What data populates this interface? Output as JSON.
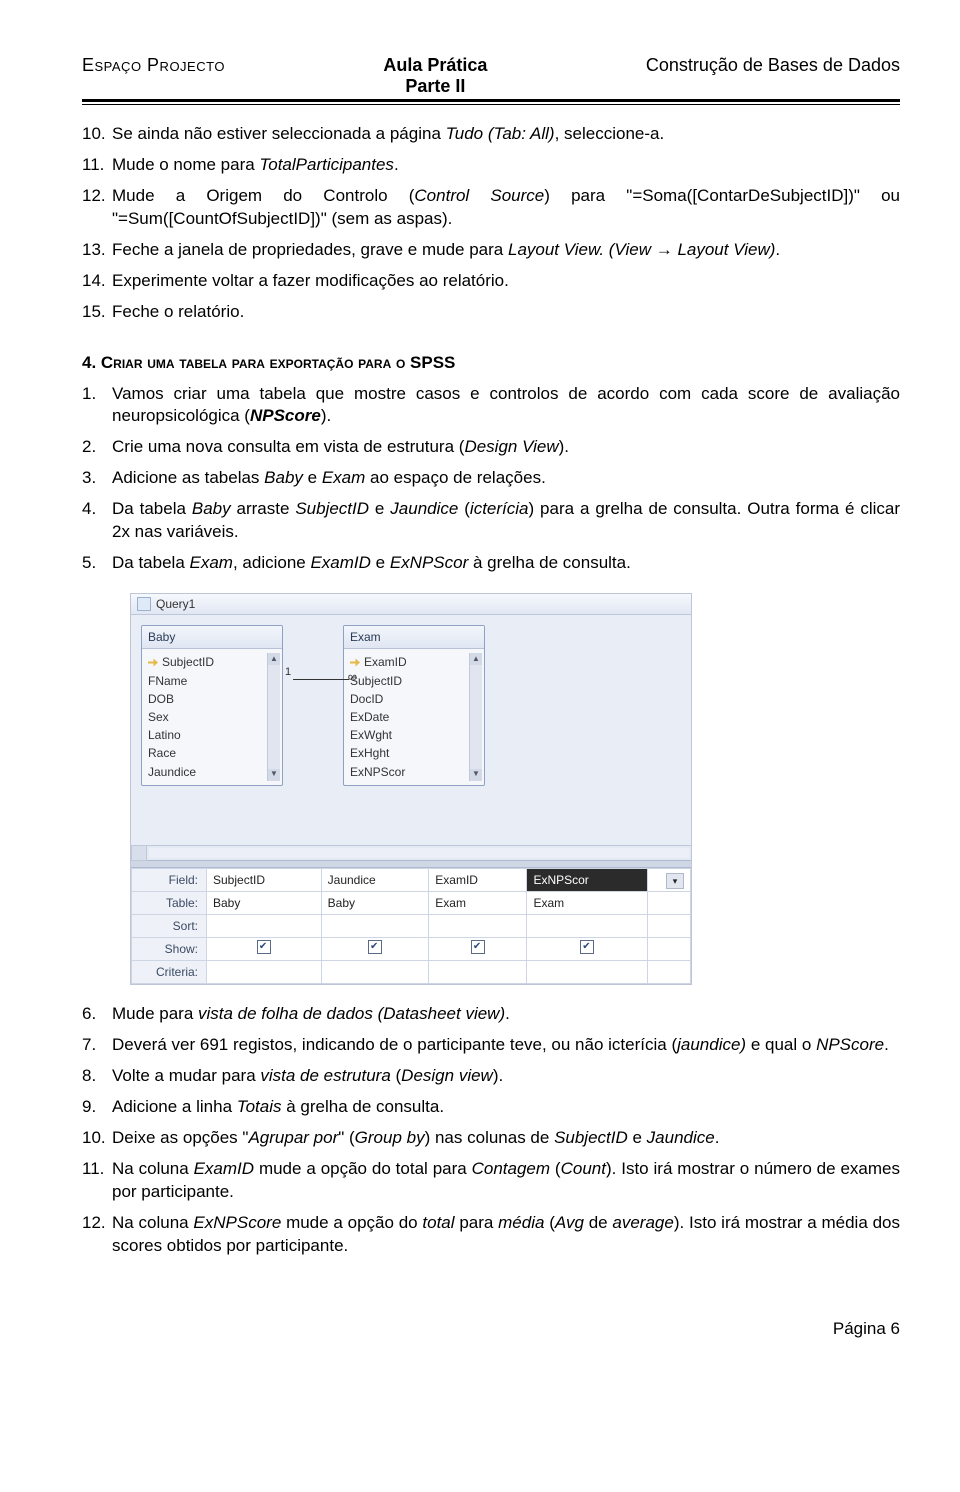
{
  "header": {
    "left": "Espaço Projecto",
    "center_line1": "Aula Prática",
    "center_line2": "Parte II",
    "right": "Construção de Bases de Dados"
  },
  "listA": {
    "i10": {
      "n": "10.",
      "t": "Se ainda não estiver seleccionada a página <span class='italic'>Tudo (Tab: All)</span>, seleccione-a."
    },
    "i11": {
      "n": "11.",
      "t": "Mude o nome para <span class='italic'>TotalParticipantes</span>."
    },
    "i12": {
      "n": "12.",
      "t": "Mude a Origem do Controlo (<span class='italic'>Control Source</span>) para \"=Soma([ContarDeSubjectID])\" ou \"=Sum([CountOfSubjectID])\" (sem as aspas)."
    },
    "i13": {
      "n": "13.",
      "t": "Feche a janela de propriedades, grave e mude para <span class='italic'>Layout View. (View → Layout View)</span>."
    },
    "i14": {
      "n": "14.",
      "t": "Experimente voltar a fazer modificações ao relatório."
    },
    "i15": {
      "n": "15.",
      "t": "Feche o relatório."
    }
  },
  "section4_title_num": "4. ",
  "section4_title_sc": "Criar uma tabela para exportação para o",
  "section4_title_bold": " SPSS",
  "listB": {
    "i1": {
      "n": "1.",
      "t": "Vamos criar uma tabela que mostre casos e controlos de acordo com cada score de avaliação neuropsicológica (<span class='bold italic'>NPScore</span>)."
    },
    "i2": {
      "n": "2.",
      "t": "Crie uma nova consulta em vista de estrutura (<span class='italic'>Design View</span>)."
    },
    "i3": {
      "n": "3.",
      "t": "Adicione as tabelas <span class='italic'>Baby</span> e <span class='italic'>Exam</span> ao espaço de relações."
    },
    "i4": {
      "n": "4.",
      "t": "Da tabela <span class='italic'>Baby</span> arraste <span class='italic'>SubjectID</span> e <span class='italic'>Jaundice</span> (<span class='italic'>icterícia</span>) para a grelha de consulta. Outra forma é clicar 2x nas variáveis."
    },
    "i5": {
      "n": "5.",
      "t": "Da tabela <span class='italic'>Exam</span>, adicione <span class='italic'>ExamID</span> e <span class='italic'>ExNPScor</span> à grelha de consulta."
    }
  },
  "figure": {
    "tab_label": "Query1",
    "baby_title": "Baby",
    "exam_title": "Exam",
    "baby_fields": [
      "SubjectID",
      "FName",
      "DOB",
      "Sex",
      "Latino",
      "Race",
      "Jaundice"
    ],
    "exam_fields": [
      "ExamID",
      "SubjectID",
      "DocID",
      "ExDate",
      "ExWght",
      "ExHght",
      "ExNPScor"
    ],
    "grid_labels": {
      "field": "Field:",
      "table": "Table:",
      "sort": "Sort:",
      "show": "Show:",
      "criteria": "Criteria:"
    },
    "grid_cols": {
      "c1": {
        "field": "SubjectID",
        "table": "Baby"
      },
      "c2": {
        "field": "Jaundice",
        "table": "Baby"
      },
      "c3": {
        "field": "ExamID",
        "table": "Exam"
      },
      "c4": {
        "field": "ExNPScor",
        "table": "Exam"
      }
    }
  },
  "listC": {
    "i6": {
      "n": "6.",
      "t": "Mude para <span class='italic'>vista de folha de dados (Datasheet view)</span>."
    },
    "i7": {
      "n": "7.",
      "t": "Deverá ver 691 registos, indicando de o participante teve, ou não icterícia (<span class='italic'>jaundice)</span> e qual o <span class='italic'>NPScore</span>."
    },
    "i8": {
      "n": "8.",
      "t": "Volte a mudar para <span class='italic'>vista de estrutura</span> (<span class='italic'>Design view</span>)."
    },
    "i9": {
      "n": "9.",
      "t": "Adicione a linha <span class='italic'>Totais</span> à grelha de consulta."
    },
    "i10": {
      "n": "10.",
      "t": "Deixe as opções \"<span class='italic'>Agrupar por</span>\" (<span class='italic'>Group by</span>) nas colunas de <span class='italic'>SubjectID</span> e <span class='italic'>Jaundice</span>."
    },
    "i11": {
      "n": "11.",
      "t": "Na coluna <span class='italic'>ExamID</span> mude a opção do total para <span class='italic'>Contagem</span> (<span class='italic'>Count</span>). Isto irá mostrar o número de exames por participante."
    },
    "i12": {
      "n": "12.",
      "t": "Na coluna <span class='italic'>ExNPScore</span> mude a opção do <span class='italic'>total</span> para <span class='italic'>média</span> (<span class='italic'>Avg</span> de <span class='italic'>average</span>). Isto irá mostrar a média dos scores obtidos por participante."
    }
  },
  "footer": "Página 6"
}
